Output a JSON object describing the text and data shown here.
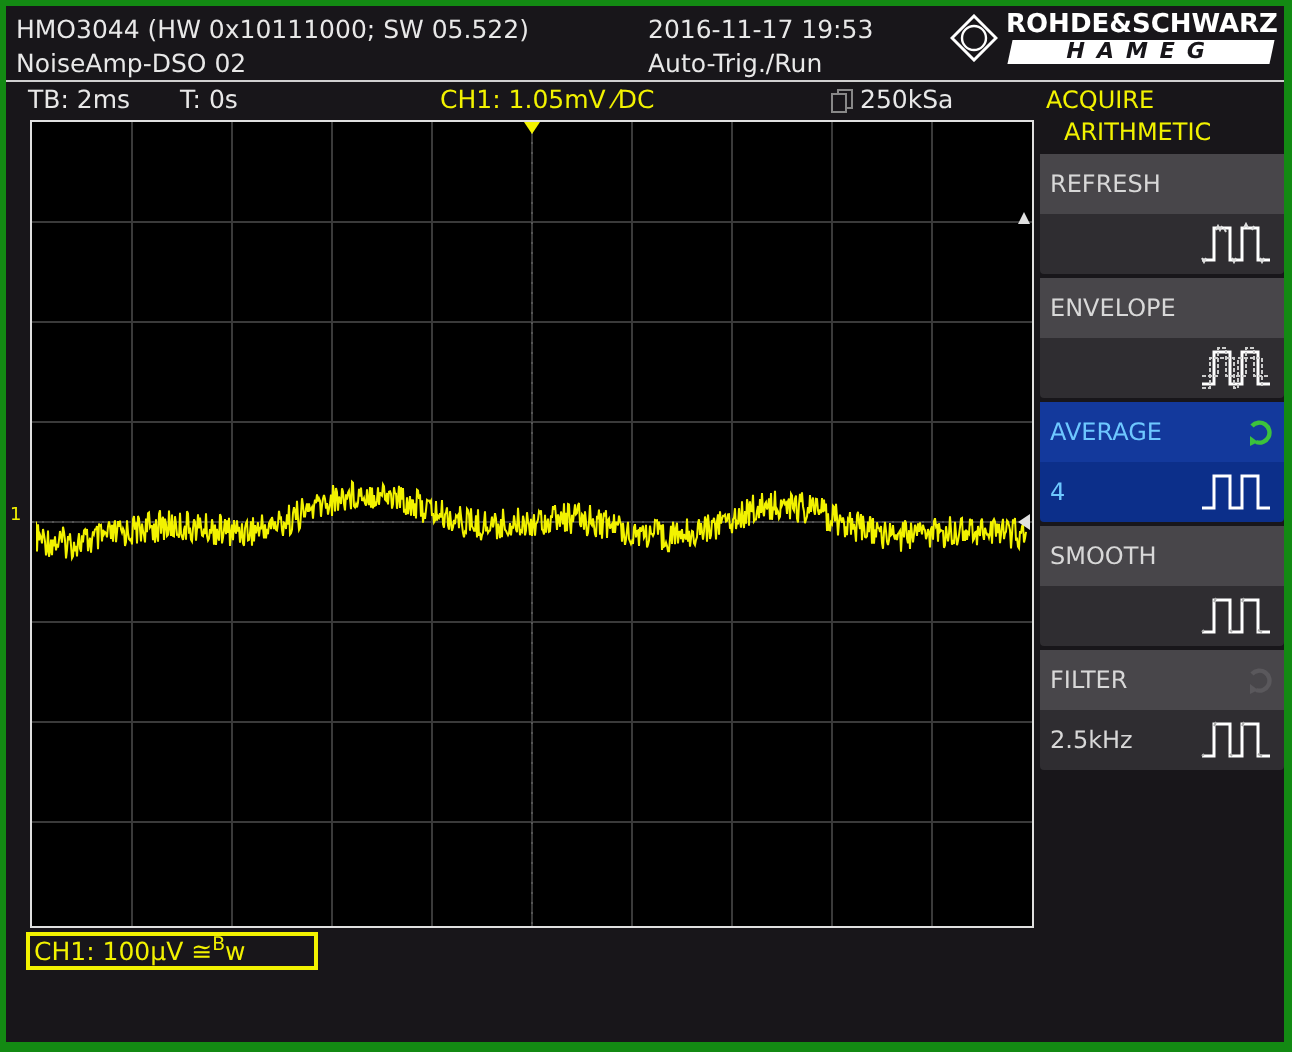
{
  "header": {
    "model": "HMO3044 (HW 0x10111000; SW 05.522)",
    "setup": "NoiseAmp-DSO 02",
    "datetime": "2016-11-17 19:53",
    "mode": "Auto-Trig./Run",
    "brand_top": "ROHDE&SCHWARZ",
    "brand_bottom": "HAMEG"
  },
  "status_bar": {
    "timebase": "TB: 2ms",
    "trigger_time": "T: 0s",
    "channel": "CH1: 1.05mV ⁄DC",
    "sample_rate": "250kSa"
  },
  "scope": {
    "channel_marker": "1"
  },
  "channel_readout": "CH1: 100µV ≅$^{B}$w",
  "menu": {
    "title": "ACQUIRE",
    "subtitle": "ARITHMETIC",
    "items": [
      {
        "label": "REFRESH",
        "kind": "noisy",
        "selected": false
      },
      {
        "label": "ENVELOPE",
        "kind": "envelope",
        "selected": false
      },
      {
        "label": "AVERAGE",
        "kind": "clean",
        "selected": true,
        "value": "4",
        "knob": true,
        "knob_disabled": false
      },
      {
        "label": "SMOOTH",
        "kind": "smooth",
        "selected": false
      },
      {
        "label": "FILTER",
        "kind": "smooth",
        "selected": false,
        "value": "2.5kHz",
        "knob": true,
        "knob_disabled": true
      }
    ]
  }
}
